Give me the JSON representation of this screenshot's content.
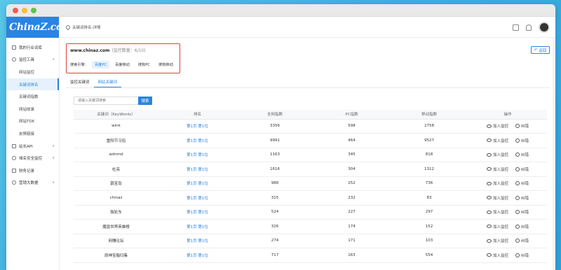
{
  "window": {
    "controls": [
      "close",
      "minimize",
      "maximize"
    ]
  },
  "brand": {
    "logo_text": "ChinaZ.com",
    "color": "#2a84e0"
  },
  "sidebar": {
    "items": [
      {
        "label": "我的行业词库",
        "icon": "book-icon",
        "level": 1,
        "active": false
      },
      {
        "label": "监控工具",
        "icon": "monitor-icon",
        "level": 1,
        "active": false,
        "highlight": true,
        "expanded": true
      },
      {
        "label": "网站监控",
        "level": 2,
        "active": false
      },
      {
        "label": "关键词排名",
        "level": 2,
        "active": true
      },
      {
        "label": "关键词指数",
        "level": 2,
        "active": false
      },
      {
        "label": "网站收录",
        "level": 2,
        "active": false
      },
      {
        "label": "网站TDK",
        "level": 2,
        "active": false
      },
      {
        "label": "友情链接",
        "level": 2,
        "active": false
      },
      {
        "label": "站长API",
        "icon": "api-icon",
        "level": 1,
        "active": false,
        "arrow": "∨"
      },
      {
        "label": "域名安全监控",
        "icon": "shield-icon",
        "level": 1,
        "active": false,
        "arrow": "∨"
      },
      {
        "label": "财务记录",
        "icon": "wallet-icon",
        "level": 1,
        "active": false
      },
      {
        "label": "营销大数据",
        "icon": "chart-icon",
        "level": 1,
        "active": false,
        "arrow": "∨"
      }
    ]
  },
  "header": {
    "breadcrumb": "关键词排名-详情"
  },
  "site": {
    "domain": "www.chinaz.com",
    "monitor_count": "(监控数量：6/10)",
    "engine_label": "搜索引擎：",
    "engines": [
      {
        "label": "百度PC",
        "active": true
      },
      {
        "label": "百度移动",
        "active": false
      },
      {
        "label": "搜狗PC",
        "active": false
      },
      {
        "label": "搜狗移动",
        "active": false
      }
    ]
  },
  "back_button": {
    "label": "返回",
    "icon": "back-icon"
  },
  "tabs": [
    {
      "label": "监控关键词",
      "active": false
    },
    {
      "label": "网站关键词",
      "active": true
    }
  ],
  "search": {
    "placeholder": "请输入关键词搜索",
    "button_label": "搜索"
  },
  "table": {
    "headers": [
      "关键词（KeyWords）",
      "排名",
      "全网指数",
      "PC指数",
      "移动指数",
      "操作"
    ],
    "op_monitor": "加入监控",
    "op_correct": "纠错",
    "rows": [
      {
        "keyword": "wink",
        "rank": "第1页 第1位",
        "all": "3356",
        "pc": "598",
        "mobile": "2758"
      },
      {
        "keyword": "重阳节习俗",
        "rank": "第1页 第1位",
        "all": "9991",
        "pc": "464",
        "mobile": "9527"
      },
      {
        "keyword": "wdnmd",
        "rank": "第1页 第1位",
        "all": "1163",
        "pc": "345",
        "mobile": "818"
      },
      {
        "keyword": "杜亮",
        "rank": "第1页 第1位",
        "all": "1616",
        "pc": "304",
        "mobile": "1312"
      },
      {
        "keyword": "鹊宝岛",
        "rank": "第1页 第1位",
        "all": "988",
        "pc": "252",
        "mobile": "736"
      },
      {
        "keyword": "chinaz",
        "rank": "第1页 第1位",
        "all": "315",
        "pc": "232",
        "mobile": "83"
      },
      {
        "keyword": "独轮车",
        "rank": "第1页 第1位",
        "all": "524",
        "pc": "227",
        "mobile": "297"
      },
      {
        "keyword": "魔兽世界英雄榜",
        "rank": "第1页 第1位",
        "all": "326",
        "pc": "174",
        "mobile": "152"
      },
      {
        "keyword": "网赚论坛",
        "rank": "第1页 第1位",
        "all": "274",
        "pc": "171",
        "mobile": "103"
      },
      {
        "keyword": "原神宝箱归集",
        "rank": "第1页 第1位",
        "all": "717",
        "pc": "163",
        "mobile": "554"
      }
    ]
  }
}
